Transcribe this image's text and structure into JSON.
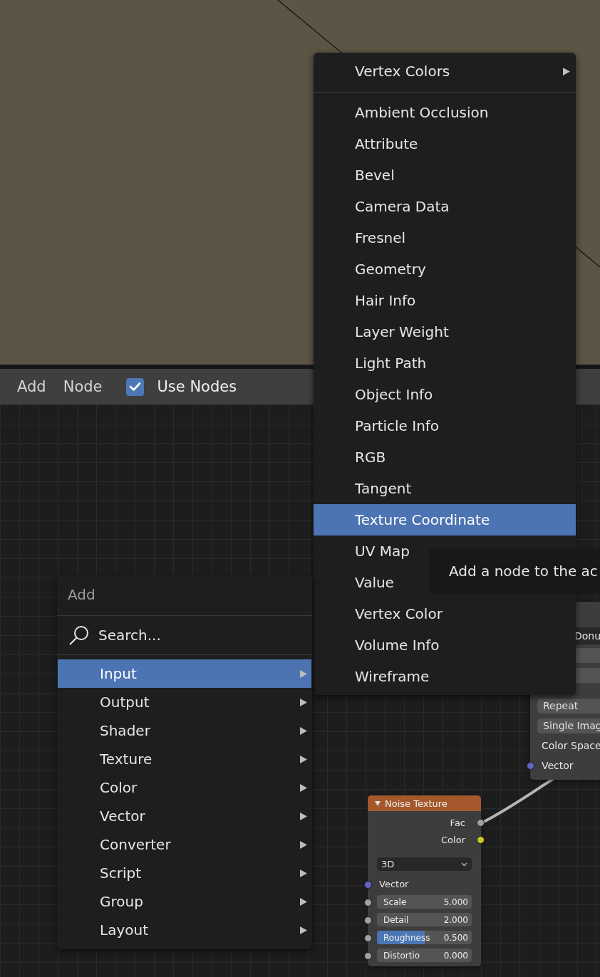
{
  "header": {
    "menus": [
      "Add",
      "Node"
    ],
    "use_nodes": {
      "label": "Use Nodes",
      "checked": true
    }
  },
  "input_submenu": {
    "groups": [
      [
        {
          "label": "Vertex Colors",
          "selected": false,
          "has_submenu": true
        }
      ],
      [
        {
          "label": "Ambient Occlusion",
          "selected": false,
          "has_submenu": false
        },
        {
          "label": "Attribute",
          "selected": false,
          "has_submenu": false
        },
        {
          "label": "Bevel",
          "selected": false,
          "has_submenu": false
        },
        {
          "label": "Camera Data",
          "selected": false,
          "has_submenu": false
        },
        {
          "label": "Fresnel",
          "selected": false,
          "has_submenu": false
        },
        {
          "label": "Geometry",
          "selected": false,
          "has_submenu": false
        },
        {
          "label": "Hair Info",
          "selected": false,
          "has_submenu": false
        },
        {
          "label": "Layer Weight",
          "selected": false,
          "has_submenu": false
        },
        {
          "label": "Light Path",
          "selected": false,
          "has_submenu": false
        },
        {
          "label": "Object Info",
          "selected": false,
          "has_submenu": false
        },
        {
          "label": "Particle Info",
          "selected": false,
          "has_submenu": false
        },
        {
          "label": "RGB",
          "selected": false,
          "has_submenu": false
        },
        {
          "label": "Tangent",
          "selected": false,
          "has_submenu": false
        },
        {
          "label": "Texture Coordinate",
          "selected": true,
          "has_submenu": false
        },
        {
          "label": "UV Map",
          "selected": false,
          "has_submenu": false
        },
        {
          "label": "Value",
          "selected": false,
          "has_submenu": false
        },
        {
          "label": "Vertex Color",
          "selected": false,
          "has_submenu": false
        },
        {
          "label": "Volume Info",
          "selected": false,
          "has_submenu": false
        },
        {
          "label": "Wireframe",
          "selected": false,
          "has_submenu": false
        }
      ]
    ]
  },
  "tooltip": {
    "text": "Add a node to the ac"
  },
  "add_menu": {
    "title": "Add",
    "search_label": "Search...",
    "items": [
      {
        "label": "Input",
        "selected": true
      },
      {
        "label": "Output",
        "selected": false
      },
      {
        "label": "Shader",
        "selected": false
      },
      {
        "label": "Texture",
        "selected": false
      },
      {
        "label": "Color",
        "selected": false
      },
      {
        "label": "Vector",
        "selected": false
      },
      {
        "label": "Converter",
        "selected": false
      },
      {
        "label": "Script",
        "selected": false
      },
      {
        "label": "Group",
        "selected": false
      },
      {
        "label": "Layout",
        "selected": false
      }
    ]
  },
  "image_node": {
    "image": "Donu",
    "fields": [
      "Repeat",
      "Single Imag"
    ],
    "color_space_label": "Color Space",
    "inputs": [
      {
        "label": "Vector",
        "color": "#6363c7"
      }
    ]
  },
  "noise_node": {
    "title": "Noise Texture",
    "outputs": [
      {
        "label": "Fac",
        "color": "#a1a1a1"
      },
      {
        "label": "Color",
        "color": "#c7c729"
      }
    ],
    "dimension": "3D",
    "inputs": [
      {
        "label": "Vector",
        "kind": "socket",
        "color": "#6363c7"
      },
      {
        "label": "Scale",
        "value": "5.000",
        "kind": "number",
        "color": "#a1a1a1"
      },
      {
        "label": "Detail",
        "value": "2.000",
        "kind": "number",
        "color": "#a1a1a1"
      },
      {
        "label": "Roughness",
        "value": "0.500",
        "kind": "slider",
        "level": 0.5,
        "color": "#a1a1a1"
      },
      {
        "label": "Distortio",
        "value": "0.000",
        "kind": "number",
        "color": "#a1a1a1"
      }
    ]
  }
}
